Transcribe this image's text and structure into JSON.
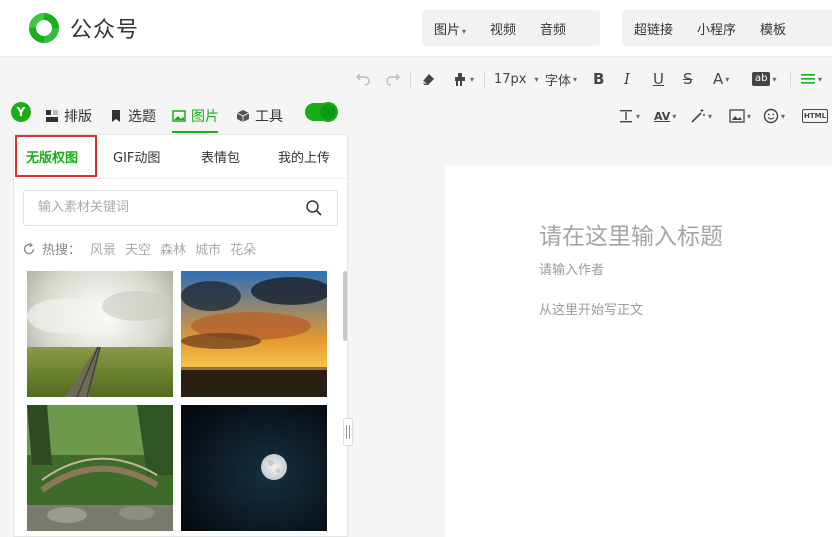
{
  "header": {
    "logo_text": "公众号",
    "media_menu": [
      {
        "label": "图片",
        "has_caret": true
      },
      {
        "label": "视频",
        "has_caret": false
      },
      {
        "label": "音频",
        "has_caret": false
      }
    ],
    "link_menu": [
      "超链接",
      "小程序",
      "模板"
    ]
  },
  "toolbar": {
    "font_size": "17px",
    "font_family": "字体",
    "icons_row1": [
      "undo-icon",
      "redo-icon",
      "eraser-icon",
      "format-painter-icon",
      "bold-icon",
      "italic-icon",
      "underline-icon",
      "strikethrough-icon",
      "font-color-icon",
      "highlight-icon",
      "align-icon"
    ],
    "icons_row2": [
      "line-height-icon",
      "letter-spacing-icon",
      "magic-wand-icon",
      "image-icon",
      "emoji-icon",
      "html-icon"
    ]
  },
  "nav_tabs": [
    {
      "label": "排版",
      "icon": "layout-icon"
    },
    {
      "label": "选题",
      "icon": "bookmark-icon"
    },
    {
      "label": "图片",
      "icon": "image-icon",
      "active": true
    },
    {
      "label": "工具",
      "icon": "cube-icon"
    }
  ],
  "panel": {
    "tabs": [
      "无版权图",
      "GIF动图",
      "表情包",
      "我的上传"
    ],
    "active_tab": "无版权图",
    "search_placeholder": "输入素材关键词",
    "hot_label": "热搜：",
    "hot_keywords": [
      "风景",
      "天空",
      "森林",
      "城市",
      "花朵"
    ],
    "thumbnails": [
      "railway-track-field",
      "sunset-clouds-lake",
      "wooden-bridge-garden",
      "full-moon-night"
    ]
  },
  "editor": {
    "title_placeholder": "请在这里输入标题",
    "author_placeholder": "请输入作者",
    "body_placeholder": "从这里开始写正文"
  },
  "colors": {
    "brand_green": "#1aad19",
    "highlight_box": "#d9332c"
  }
}
